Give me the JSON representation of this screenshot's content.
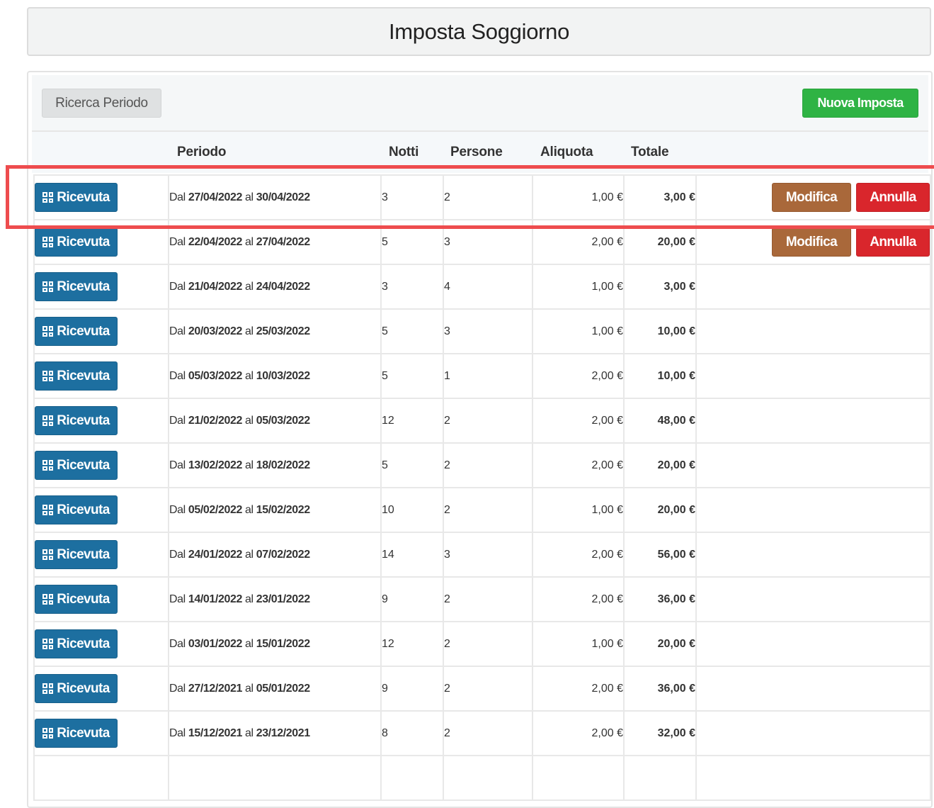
{
  "page_title": "Imposta Soggiorno",
  "toolbar": {
    "search_label": "Ricerca Periodo",
    "new_label": "Nuova Imposta"
  },
  "columns": {
    "periodo": "Periodo",
    "notti": "Notti",
    "persone": "Persone",
    "aliquota": "Aliquota",
    "totale": "Totale"
  },
  "labels": {
    "receipt": "Ricevuta",
    "edit": "Modifica",
    "cancel": "Annulla",
    "from": "Dal",
    "to": "al"
  },
  "rows": [
    {
      "from": "27/04/2022",
      "to": "30/04/2022",
      "notti": "3",
      "persone": "2",
      "aliquota": "1,00 €",
      "totale": "3,00 €",
      "editable": true,
      "highlighted": true
    },
    {
      "from": "22/04/2022",
      "to": "27/04/2022",
      "notti": "5",
      "persone": "3",
      "aliquota": "2,00 €",
      "totale": "20,00 €",
      "editable": true
    },
    {
      "from": "21/04/2022",
      "to": "24/04/2022",
      "notti": "3",
      "persone": "4",
      "aliquota": "1,00 €",
      "totale": "3,00 €",
      "editable": false
    },
    {
      "from": "20/03/2022",
      "to": "25/03/2022",
      "notti": "5",
      "persone": "3",
      "aliquota": "1,00 €",
      "totale": "10,00 €",
      "editable": false
    },
    {
      "from": "05/03/2022",
      "to": "10/03/2022",
      "notti": "5",
      "persone": "1",
      "aliquota": "2,00 €",
      "totale": "10,00 €",
      "editable": false
    },
    {
      "from": "21/02/2022",
      "to": "05/03/2022",
      "notti": "12",
      "persone": "2",
      "aliquota": "2,00 €",
      "totale": "48,00 €",
      "editable": false
    },
    {
      "from": "13/02/2022",
      "to": "18/02/2022",
      "notti": "5",
      "persone": "2",
      "aliquota": "2,00 €",
      "totale": "20,00 €",
      "editable": false
    },
    {
      "from": "05/02/2022",
      "to": "15/02/2022",
      "notti": "10",
      "persone": "2",
      "aliquota": "1,00 €",
      "totale": "20,00 €",
      "editable": false
    },
    {
      "from": "24/01/2022",
      "to": "07/02/2022",
      "notti": "14",
      "persone": "3",
      "aliquota": "2,00 €",
      "totale": "56,00 €",
      "editable": false
    },
    {
      "from": "14/01/2022",
      "to": "23/01/2022",
      "notti": "9",
      "persone": "2",
      "aliquota": "2,00 €",
      "totale": "36,00 €",
      "editable": false
    },
    {
      "from": "03/01/2022",
      "to": "15/01/2022",
      "notti": "12",
      "persone": "2",
      "aliquota": "1,00 €",
      "totale": "20,00 €",
      "editable": false
    },
    {
      "from": "27/12/2021",
      "to": "05/01/2022",
      "notti": "9",
      "persone": "2",
      "aliquota": "2,00 €",
      "totale": "36,00 €",
      "editable": false
    },
    {
      "from": "15/12/2021",
      "to": "23/12/2021",
      "notti": "8",
      "persone": "2",
      "aliquota": "2,00 €",
      "totale": "32,00 €",
      "editable": false
    },
    {
      "from": "",
      "to": "",
      "notti": "",
      "persone": "",
      "aliquota": "",
      "totale": "",
      "editable": false,
      "partial": true
    }
  ],
  "colors": {
    "receipt_button": "#1d6fa0",
    "edit_button": "#a9683a",
    "cancel_button": "#d9262c",
    "new_button": "#2fb344",
    "highlight_border": "#ee4c4e"
  }
}
